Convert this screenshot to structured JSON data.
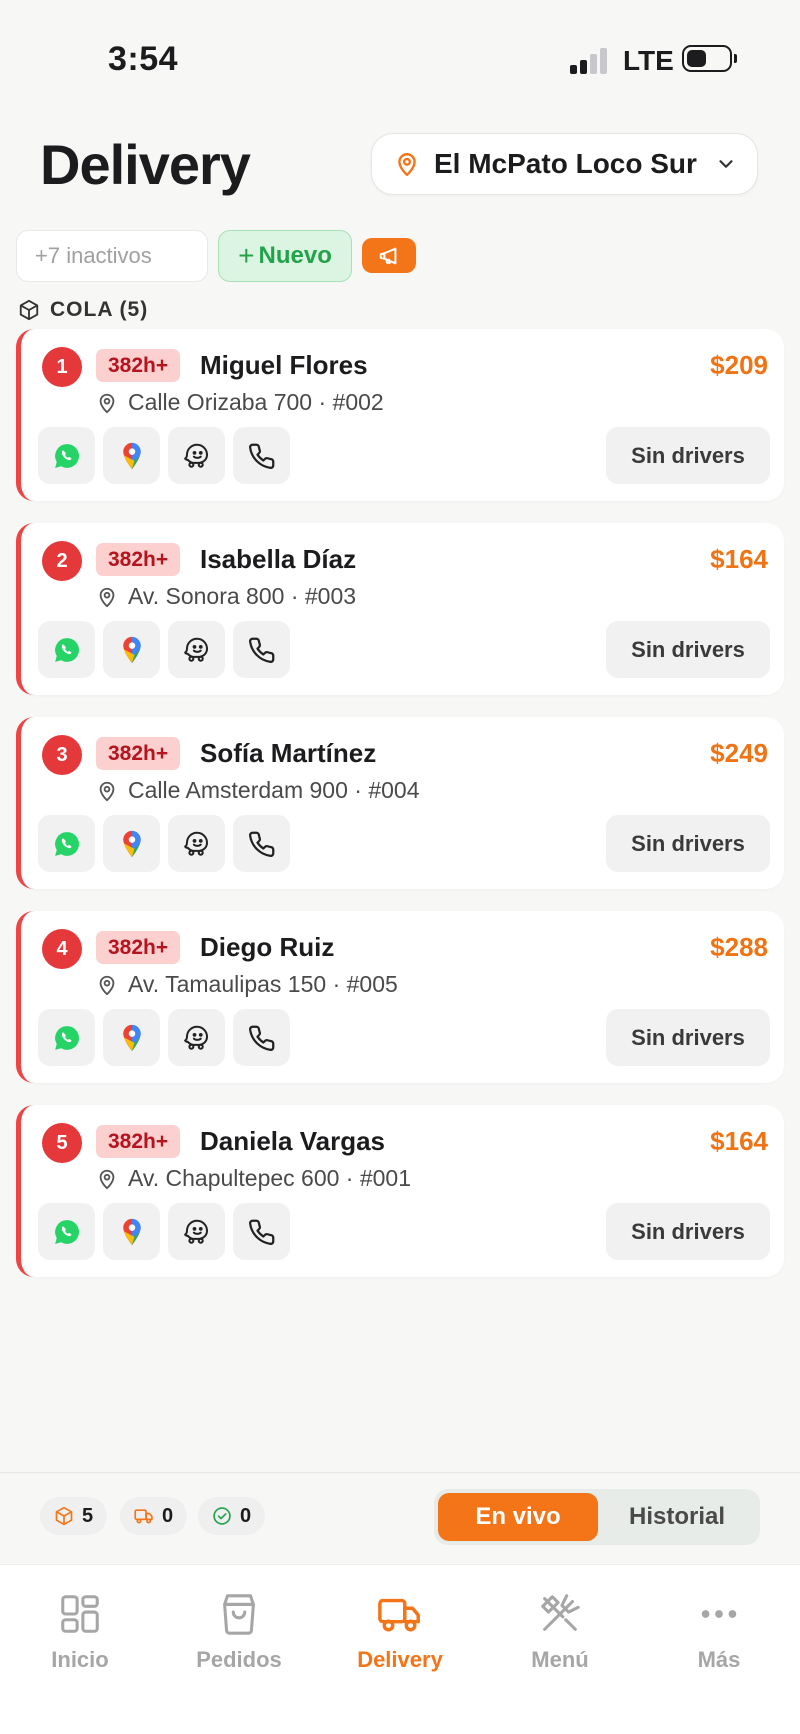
{
  "status_bar": {
    "time": "3:54",
    "network": "LTE",
    "battery_level": 0.55
  },
  "header": {
    "title": "Delivery",
    "location": "El McPato Loco Sur"
  },
  "filters": {
    "inactive_placeholder": "+7 inactivos",
    "new_label": "Nuevo"
  },
  "queue": {
    "label": "COLA (5)"
  },
  "orders": [
    {
      "num": "1",
      "wait": "382h+",
      "name": "Miguel Flores",
      "total": "$209",
      "address": "Calle Orizaba 700 · #002",
      "status": "Sin drivers"
    },
    {
      "num": "2",
      "wait": "382h+",
      "name": "Isabella Díaz",
      "total": "$164",
      "address": "Av. Sonora 800 · #003",
      "status": "Sin drivers"
    },
    {
      "num": "3",
      "wait": "382h+",
      "name": "Sofía Martínez",
      "total": "$249",
      "address": "Calle Amsterdam 900 · #004",
      "status": "Sin drivers"
    },
    {
      "num": "4",
      "wait": "382h+",
      "name": "Diego Ruiz",
      "total": "$288",
      "address": "Av. Tamaulipas 150 · #005",
      "status": "Sin drivers"
    },
    {
      "num": "5",
      "wait": "382h+",
      "name": "Daniela Vargas",
      "total": "$164",
      "address": "Av. Chapultepec 600 · #001",
      "status": "Sin drivers"
    }
  ],
  "summary": {
    "queued": "5",
    "in_transit": "0",
    "delivered": "0"
  },
  "view_toggle": {
    "live": "En vivo",
    "history": "Historial"
  },
  "tabs": [
    {
      "label": "Inicio",
      "icon": "grid-icon"
    },
    {
      "label": "Pedidos",
      "icon": "bag-icon"
    },
    {
      "label": "Delivery",
      "icon": "truck-icon"
    },
    {
      "label": "Menú",
      "icon": "utensils-icon"
    },
    {
      "label": "Más",
      "icon": "more-icon"
    }
  ],
  "colors": {
    "accent": "#f47418",
    "danger": "#e5383b",
    "success": "#22a34a"
  }
}
